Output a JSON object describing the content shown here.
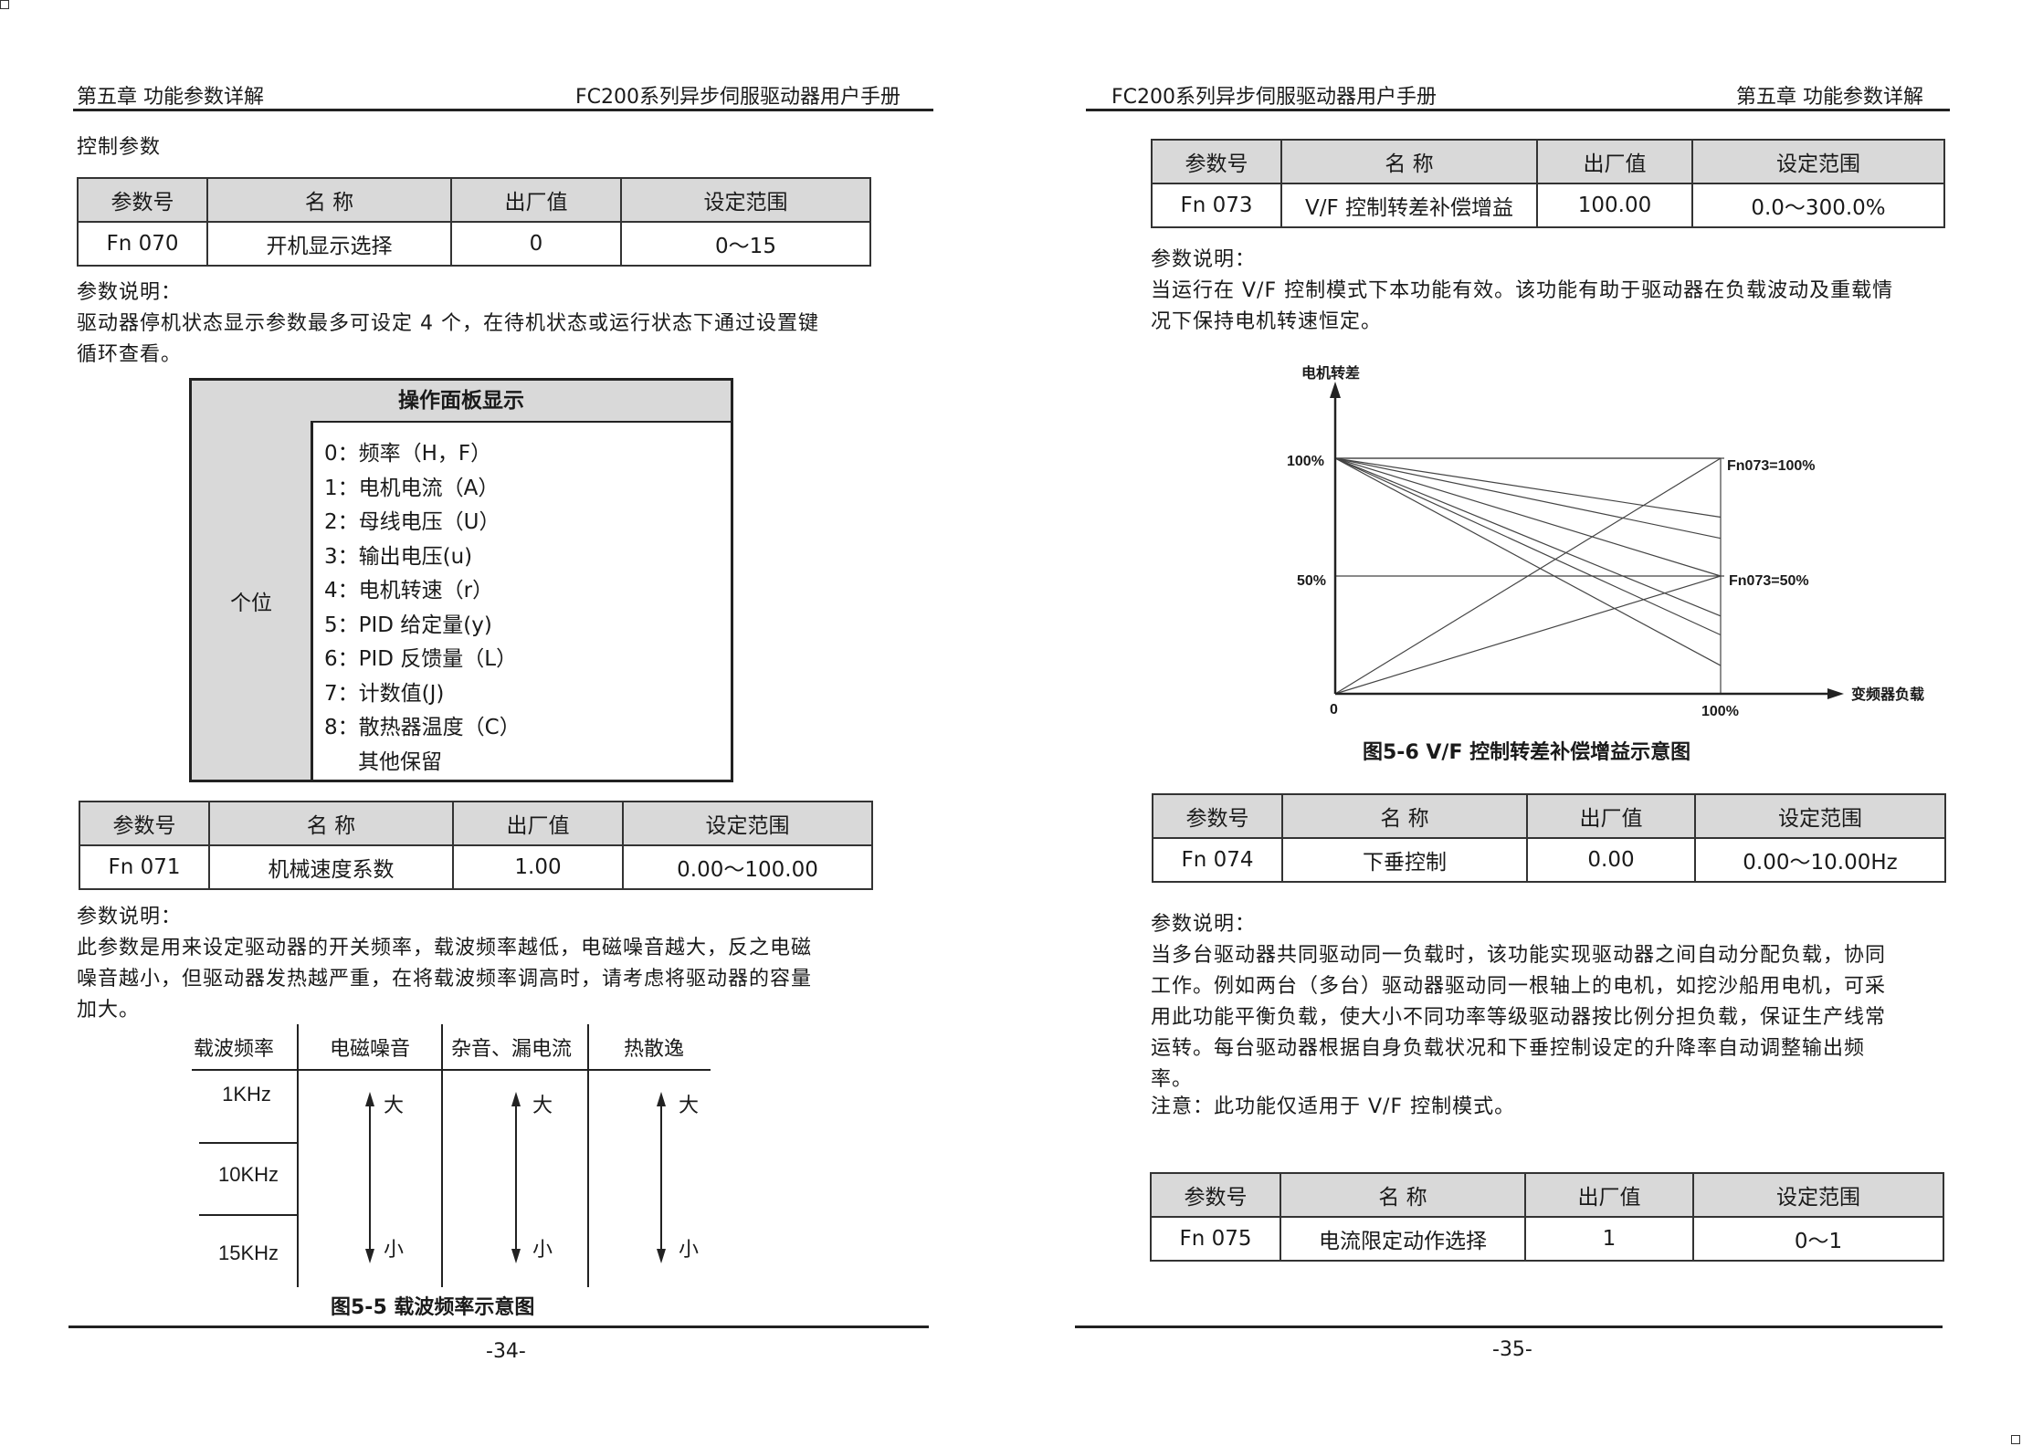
{
  "left": {
    "header": {
      "chapter": "第五章 功能参数详解",
      "manual": "FC200系列异步伺服驱动器用户手册"
    },
    "section_title": "控制参数",
    "table_columns": [
      "参数号",
      "名 称",
      "出厂值",
      "设定范围"
    ],
    "fn070": {
      "id": "Fn 070",
      "name": "开机显示选择",
      "default": "0",
      "range": "0～15"
    },
    "fn070_desc_label": "参数说明：",
    "fn070_desc_lines": [
      "驱动器停机状态显示参数最多可设定 4 个，在待机状态或运行状态下通过设置键",
      "循环查看。"
    ],
    "panel": {
      "title": "操作面板显示",
      "left_label": "个位",
      "items": [
        "0：频率（H，F）",
        "1：电机电流（A）",
        "2：母线电压（U）",
        "3：输出电压(u)",
        "4：电机转速（r）",
        "5：PID 给定量(y)",
        "6：PID 反馈量（L）",
        "7：计数值(J)",
        "8：散热器温度（C）",
        "其他保留"
      ]
    },
    "fn071": {
      "id": "Fn 071",
      "name": "机械速度系数",
      "default": "1.00",
      "range": "0.00～100.00"
    },
    "fn071_desc_label": "参数说明：",
    "fn071_desc_lines": [
      "此参数是用来设定驱动器的开关频率，载波频率越低，电磁噪音越大，反之电磁",
      "噪音越小，但驱动器发热越严重，在将载波频率调高时，请考虑将驱动器的容量",
      "加大。"
    ],
    "carrier": {
      "headers": [
        "载波频率",
        "电磁噪音",
        "杂音、漏电流",
        "热散逸"
      ],
      "freqs": [
        "1KHz",
        "10KHz",
        "15KHz"
      ],
      "big": "大",
      "small": "小"
    },
    "figure_caption": "图5-5  载波频率示意图",
    "page_number": "-34-"
  },
  "right": {
    "header": {
      "manual": "FC200系列异步伺服驱动器用户手册",
      "chapter": "第五章 功能参数详解"
    },
    "table_columns": [
      "参数号",
      "名 称",
      "出厂值",
      "设定范围"
    ],
    "fn073": {
      "id": "Fn 073",
      "name": "V/F 控制转差补偿增益",
      "default": "100.00",
      "range": "0.0～300.0%"
    },
    "fn073_desc_label": "参数说明：",
    "fn073_desc_lines": [
      "当运行在 V/F 控制模式下本功能有效。该功能有助于驱动器在负载波动及重载情",
      "况下保持电机转速恒定。"
    ],
    "chart_data": {
      "type": "line",
      "ylabel": "电机转差",
      "xlabel": "变频器负载",
      "y_ticks": [
        "100%",
        "50%"
      ],
      "x_ticks": [
        "0",
        "100%"
      ],
      "annotations": [
        "Fn073=100%",
        "Fn073=50%"
      ],
      "x": [
        0,
        100
      ],
      "series": [
        {
          "values": [
            100,
            100
          ]
        },
        {
          "values": [
            100,
            75
          ]
        },
        {
          "values": [
            100,
            66
          ]
        },
        {
          "values": [
            100,
            50
          ]
        },
        {
          "values": [
            100,
            33
          ]
        },
        {
          "values": [
            100,
            25
          ]
        },
        {
          "values": [
            100,
            12
          ]
        },
        {
          "values": [
            0,
            100
          ]
        },
        {
          "values": [
            0,
            50
          ]
        }
      ],
      "xlim": [
        0,
        100
      ],
      "ylim": [
        0,
        100
      ],
      "grid": false
    },
    "figure_caption": "图5-6 V/F 控制转差补偿增益示意图",
    "fn074": {
      "id": "Fn 074",
      "name": "下垂控制",
      "default": "0.00",
      "range": "0.00～10.00Hz"
    },
    "fn074_desc_label": "参数说明：",
    "fn074_desc_lines": [
      "当多台驱动器共同驱动同一负载时，该功能实现驱动器之间自动分配负载，协同",
      "工作。例如两台（多台）驱动器驱动同一根轴上的电机，如挖沙船用电机，可采",
      "用此功能平衡负载，使大小不同功率等级驱动器按比例分担负载，保证生产线常",
      "运转。每台驱动器根据自身负载状况和下垂控制设定的升降率自动调整输出频",
      "率。"
    ],
    "fn074_note": "注意：此功能仅适用于 V/F 控制模式。",
    "fn075": {
      "id": "Fn 075",
      "name": "电流限定动作选择",
      "default": "1",
      "range": "0～1"
    },
    "page_number": "-35-"
  }
}
